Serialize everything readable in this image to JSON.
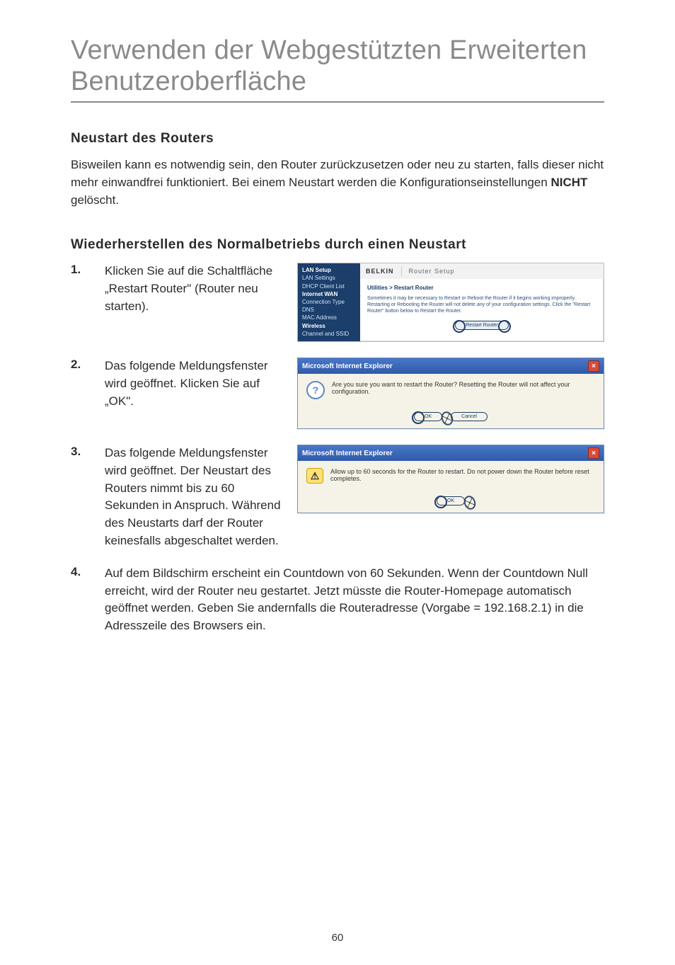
{
  "page": {
    "title": "Verwenden der Webgestützten Erweiterten Benutzeroberfläche",
    "number": "60"
  },
  "section1": {
    "heading": "Neustart des Routers",
    "para_before": "Bisweilen kann es notwendig sein, den Router zurückzusetzen oder neu zu starten, falls dieser nicht mehr einwandfrei funktioniert. Bei einem Neustart werden die Konfigurationseinstellungen ",
    "nicht": "NICHT",
    "para_after": " gelöscht."
  },
  "section2": {
    "heading": "Wiederherstellen des Normalbetriebs durch einen Neustart"
  },
  "steps": {
    "s1": {
      "num": "1.",
      "text": "Klicken Sie auf die Schaltfläche „Restart Router\" (Router neu starten)."
    },
    "s2": {
      "num": "2.",
      "text": "Das folgende Meldungsfenster wird geöffnet. Klicken Sie auf „OK\"."
    },
    "s3": {
      "num": "3.",
      "text": "Das folgende Meldungsfenster wird geöffnet. Der Neustart des Routers nimmt bis zu 60 Sekunden in Anspruch. Während des Neustarts darf der Router keinesfalls abgeschaltet werden."
    },
    "s4": {
      "num": "4.",
      "text": "Auf dem Bildschirm erscheint ein Countdown von 60 Sekunden. Wenn der Countdown Null erreicht, wird der Router neu gestartet. Jetzt müsste die Router-Homepage automatisch geöffnet werden. Geben Sie andernfalls die Routeradresse (Vorgabe = 192.168.2.1) in die Adresszeile des Browsers ein."
    }
  },
  "shot1": {
    "brand": "BELKIN",
    "header": "Router Setup",
    "side": {
      "a": "LAN Setup",
      "a1": "LAN Settings",
      "a2": "DHCP Client List",
      "b": "Internet WAN",
      "b1": "Connection Type",
      "b2": "DNS",
      "b3": "MAC Address",
      "c": "Wireless",
      "c1": "Channel and SSID"
    },
    "crumb": "Utilities > Restart Router",
    "desc": "Sometimes it may be necessary to Restart or Reboot the Router if it begins working improperly. Restarting or Rebooting the Router will not delete any of your configuration settings. Click the \"Restart Router\" button below to Restart the Router.",
    "btn": "Restart Router"
  },
  "dlg_q": {
    "title": "Microsoft Internet Explorer",
    "msg": "Are you sure you want to restart the Router? Resetting the Router will not affect your configuration.",
    "ok": "OK",
    "cancel": "Cancel"
  },
  "dlg_w": {
    "title": "Microsoft Internet Explorer",
    "msg": "Allow up to 60 seconds for the Router to restart. Do not power down the Router before reset completes.",
    "ok": "OK"
  }
}
